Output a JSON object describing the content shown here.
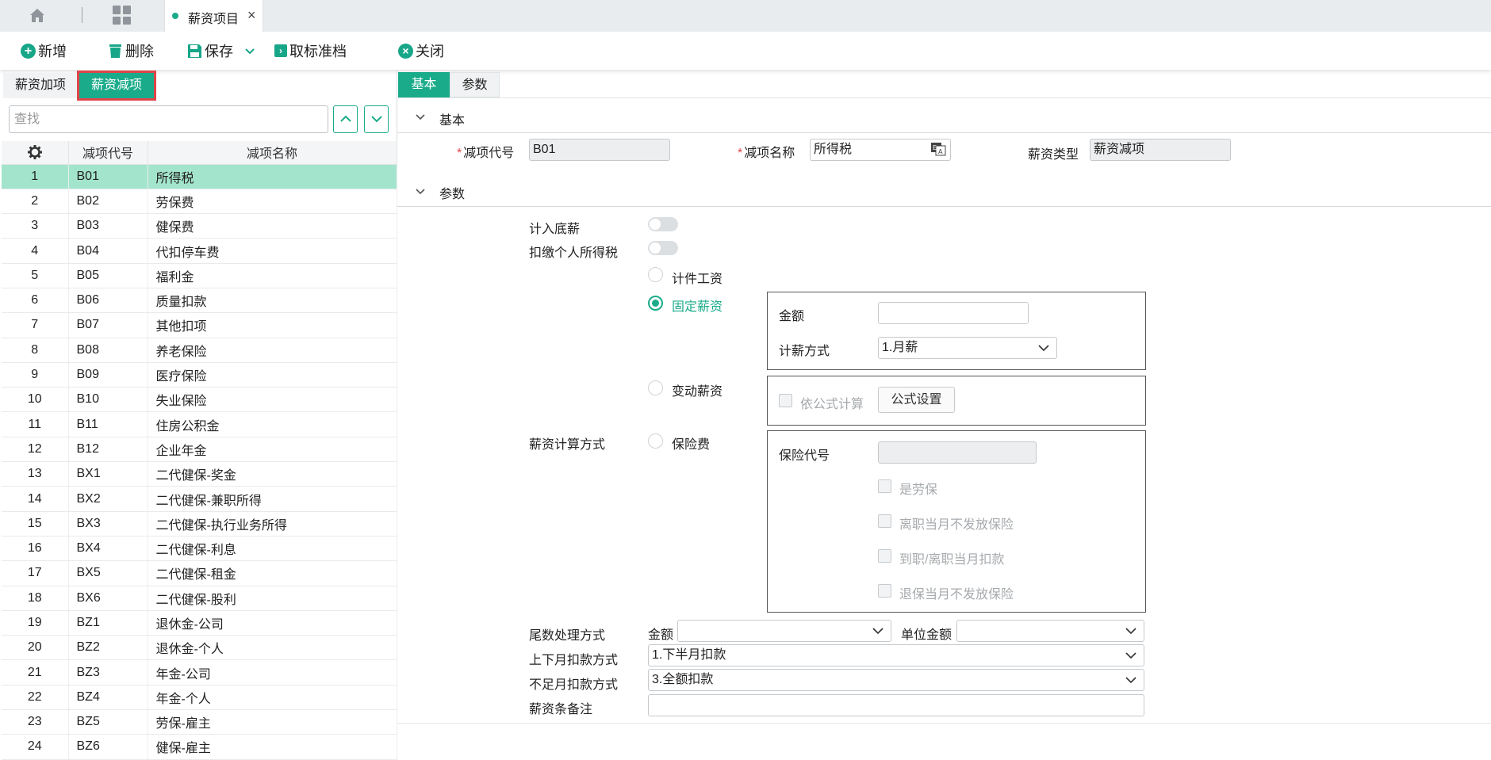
{
  "tabs": {
    "home_icon": "home-icon",
    "apps_icon": "grid-icon",
    "doc_tab_label": "薪资项目",
    "close_glyph": "×"
  },
  "toolbar": {
    "add_label": "新增",
    "delete_label": "删除",
    "save_label": "保存",
    "cancel_archive_label": "取标准档",
    "close_label": "关闭"
  },
  "left": {
    "tab_add": "薪资加项",
    "tab_deduct": "薪资减项",
    "search_placeholder": "查找",
    "columns": [
      "减项代号",
      "减项名称"
    ],
    "rows": [
      {
        "n": "1",
        "code": "B01",
        "name": "所得税"
      },
      {
        "n": "2",
        "code": "B02",
        "name": "劳保费"
      },
      {
        "n": "3",
        "code": "B03",
        "name": "健保费"
      },
      {
        "n": "4",
        "code": "B04",
        "name": "代扣停车费"
      },
      {
        "n": "5",
        "code": "B05",
        "name": "福利金"
      },
      {
        "n": "6",
        "code": "B06",
        "name": "质量扣款"
      },
      {
        "n": "7",
        "code": "B07",
        "name": "其他扣项"
      },
      {
        "n": "8",
        "code": "B08",
        "name": "养老保险"
      },
      {
        "n": "9",
        "code": "B09",
        "name": "医疗保险"
      },
      {
        "n": "10",
        "code": "B10",
        "name": "失业保险"
      },
      {
        "n": "11",
        "code": "B11",
        "name": "住房公积金"
      },
      {
        "n": "12",
        "code": "B12",
        "name": "企业年金"
      },
      {
        "n": "13",
        "code": "BX1",
        "name": "二代健保-奖金"
      },
      {
        "n": "14",
        "code": "BX2",
        "name": "二代健保-兼职所得"
      },
      {
        "n": "15",
        "code": "BX3",
        "name": "二代健保-执行业务所得"
      },
      {
        "n": "16",
        "code": "BX4",
        "name": "二代健保-利息"
      },
      {
        "n": "17",
        "code": "BX5",
        "name": "二代健保-租金"
      },
      {
        "n": "18",
        "code": "BX6",
        "name": "二代健保-股利"
      },
      {
        "n": "19",
        "code": "BZ1",
        "name": "退休金-公司"
      },
      {
        "n": "20",
        "code": "BZ2",
        "name": "退休金-个人"
      },
      {
        "n": "21",
        "code": "BZ3",
        "name": "年金-公司"
      },
      {
        "n": "22",
        "code": "BZ4",
        "name": "年金-个人"
      },
      {
        "n": "23",
        "code": "BZ5",
        "name": "劳保-雇主"
      },
      {
        "n": "24",
        "code": "BZ6",
        "name": "健保-雇主"
      }
    ],
    "selected_row": 0
  },
  "right": {
    "tab_basic": "基本",
    "tab_params": "参数",
    "section_basic": "基本",
    "section_params": "参数",
    "req_mark": "*",
    "code_label": "减项代号",
    "code_value": "B01",
    "name_label": "减项名称",
    "name_value": "所得税",
    "type_label": "薪资类型",
    "type_value": "薪资减项",
    "include_base_label": "计入底薪",
    "withhold_tax_label": "扣缴个人所得税",
    "calc_method_label": "薪资计算方式",
    "radio_piece": "计件工资",
    "radio_fixed": "固定薪资",
    "radio_variable": "变动薪资",
    "radio_insurance": "保险费",
    "amount_label": "金额",
    "amount_value": "",
    "pay_method_label": "计薪方式",
    "pay_method_value": "1.月薪",
    "formula_calc_label": "依公式计算",
    "formula_setup_button": "公式设置",
    "insurance_code_label": "保险代号",
    "insurance_code_value": "",
    "chk_labor": "是劳保",
    "chk_resign_month": "离职当月不发放保险",
    "chk_join_resign": "到职/离职当月扣款",
    "chk_withdraw_month": "退保当月不发放保险",
    "rounding_label": "尾数处理方式",
    "rounding_amount_label": "金额",
    "rounding_amount_value": "",
    "unit_amount_label": "单位金额",
    "unit_amount_value": "",
    "half_month_label": "上下月扣款方式",
    "half_month_value": "1.下半月扣款",
    "insufficient_label": "不足月扣款方式",
    "insufficient_value": "3.全额扣款",
    "remark_label": "薪资条备注",
    "remark_value": ""
  },
  "colors": {
    "accent": "#1aab8a",
    "selected_row": "#a3e4cd",
    "highlight_outline": "#e0454a"
  }
}
